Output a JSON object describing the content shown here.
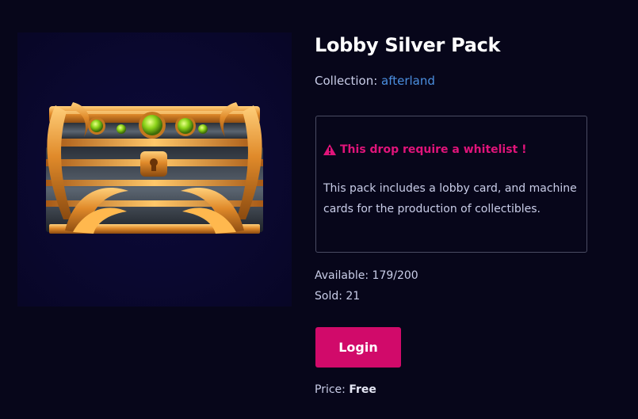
{
  "pack": {
    "title": "Lobby Silver Pack",
    "collection_label": "Collection:",
    "collection_name": "afterland",
    "warning": "This drop require a whitelist !",
    "description": "This pack includes a lobby card, and machine cards for the production of collectibles.",
    "available": "Available: 179/200",
    "sold": "Sold: 21",
    "price_label": "Price:",
    "price_value": "Free"
  },
  "actions": {
    "login_label": "Login"
  },
  "icons": {
    "warning": "warning-triangle-icon"
  },
  "colors": {
    "background": "#07061a",
    "accent": "#d10a6a",
    "warning": "#e0147a",
    "link": "#4b8fe0",
    "title": "#ffffff",
    "text": "#c9cde8"
  }
}
